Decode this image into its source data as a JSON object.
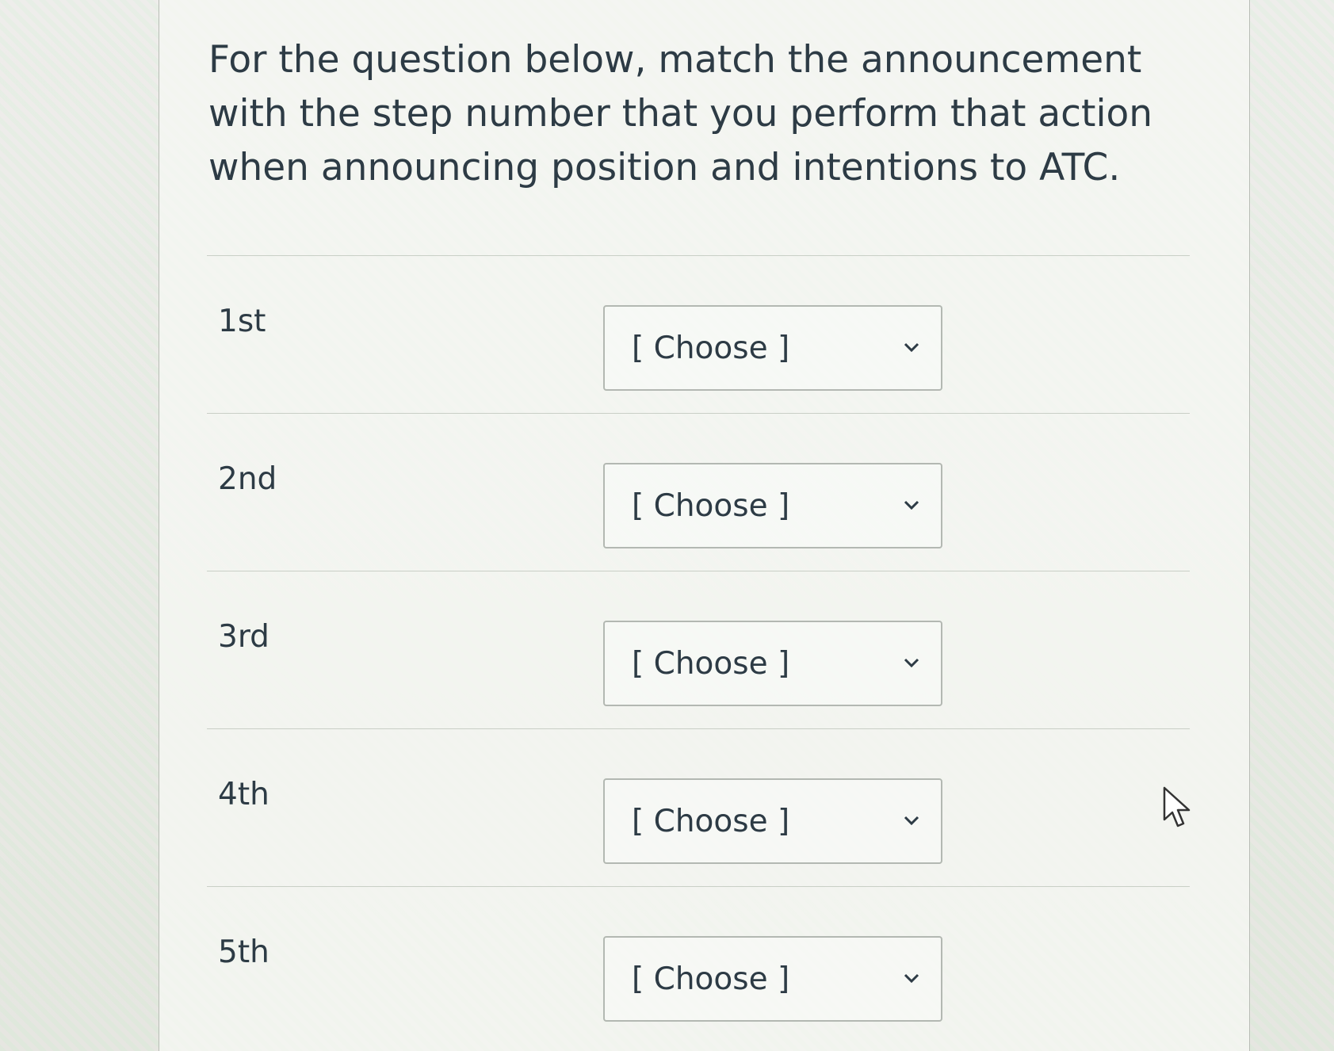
{
  "question": {
    "text": "For the question below, match the announcement with the step number that you perform that action when announcing position and intentions to ATC."
  },
  "answers": [
    {
      "label": "1st",
      "selected": "[ Choose ]"
    },
    {
      "label": "2nd",
      "selected": "[ Choose ]"
    },
    {
      "label": "3rd",
      "selected": "[ Choose ]"
    },
    {
      "label": "4th",
      "selected": "[ Choose ]"
    },
    {
      "label": "5th",
      "selected": "[ Choose ]"
    }
  ],
  "icons": {
    "dropdown": "chevron-down-icon",
    "pointer": "mouse-pointer-icon"
  },
  "colors": {
    "text": "#2d3b45",
    "border": "#b3b8b2"
  }
}
